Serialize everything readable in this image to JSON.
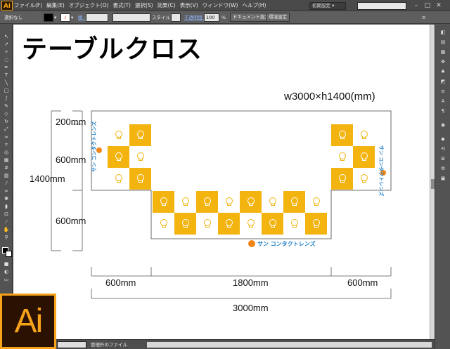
{
  "app": {
    "logo_small": "Ai",
    "logo_large": "Ai"
  },
  "menu": [
    "ファイル(F)",
    "編集(E)",
    "オブジェクト(O)",
    "書式(T)",
    "選択(S)",
    "効果(C)",
    "表示(V)",
    "ウィンドウ(W)",
    "ヘルプ(H)"
  ],
  "workspace": "初期設定 ▾",
  "window_buttons": [
    "–",
    "□",
    "✕"
  ],
  "control_bar": {
    "selection": "選択なし",
    "stroke_label": "線 :",
    "style_label": "スタイル :",
    "opacity_label": "不透明度 :",
    "opacity_value": "100",
    "opacity_unit": "%",
    "doc_settings": "ドキュメント設定",
    "env_settings": "環境設定"
  },
  "status": {
    "zoom": "",
    "text": "管理外のファイル"
  },
  "artboard": {
    "title": "テーブルクロス",
    "size_label": "w3000×h1400(mm)",
    "dims": {
      "h200": "200mm",
      "h600_top": "600mm",
      "h1400": "1400mm",
      "h600_bottom": "600mm",
      "w600_left": "600mm",
      "w1800": "1800mm",
      "w600_right": "600mm",
      "w3000": "3000mm"
    },
    "brand_logo": "サン コンタクトレンズ"
  },
  "colors": {
    "accent": "#f3b40f",
    "brand_blue": "#1f7fc8",
    "app_orange": "#f7a21b"
  }
}
